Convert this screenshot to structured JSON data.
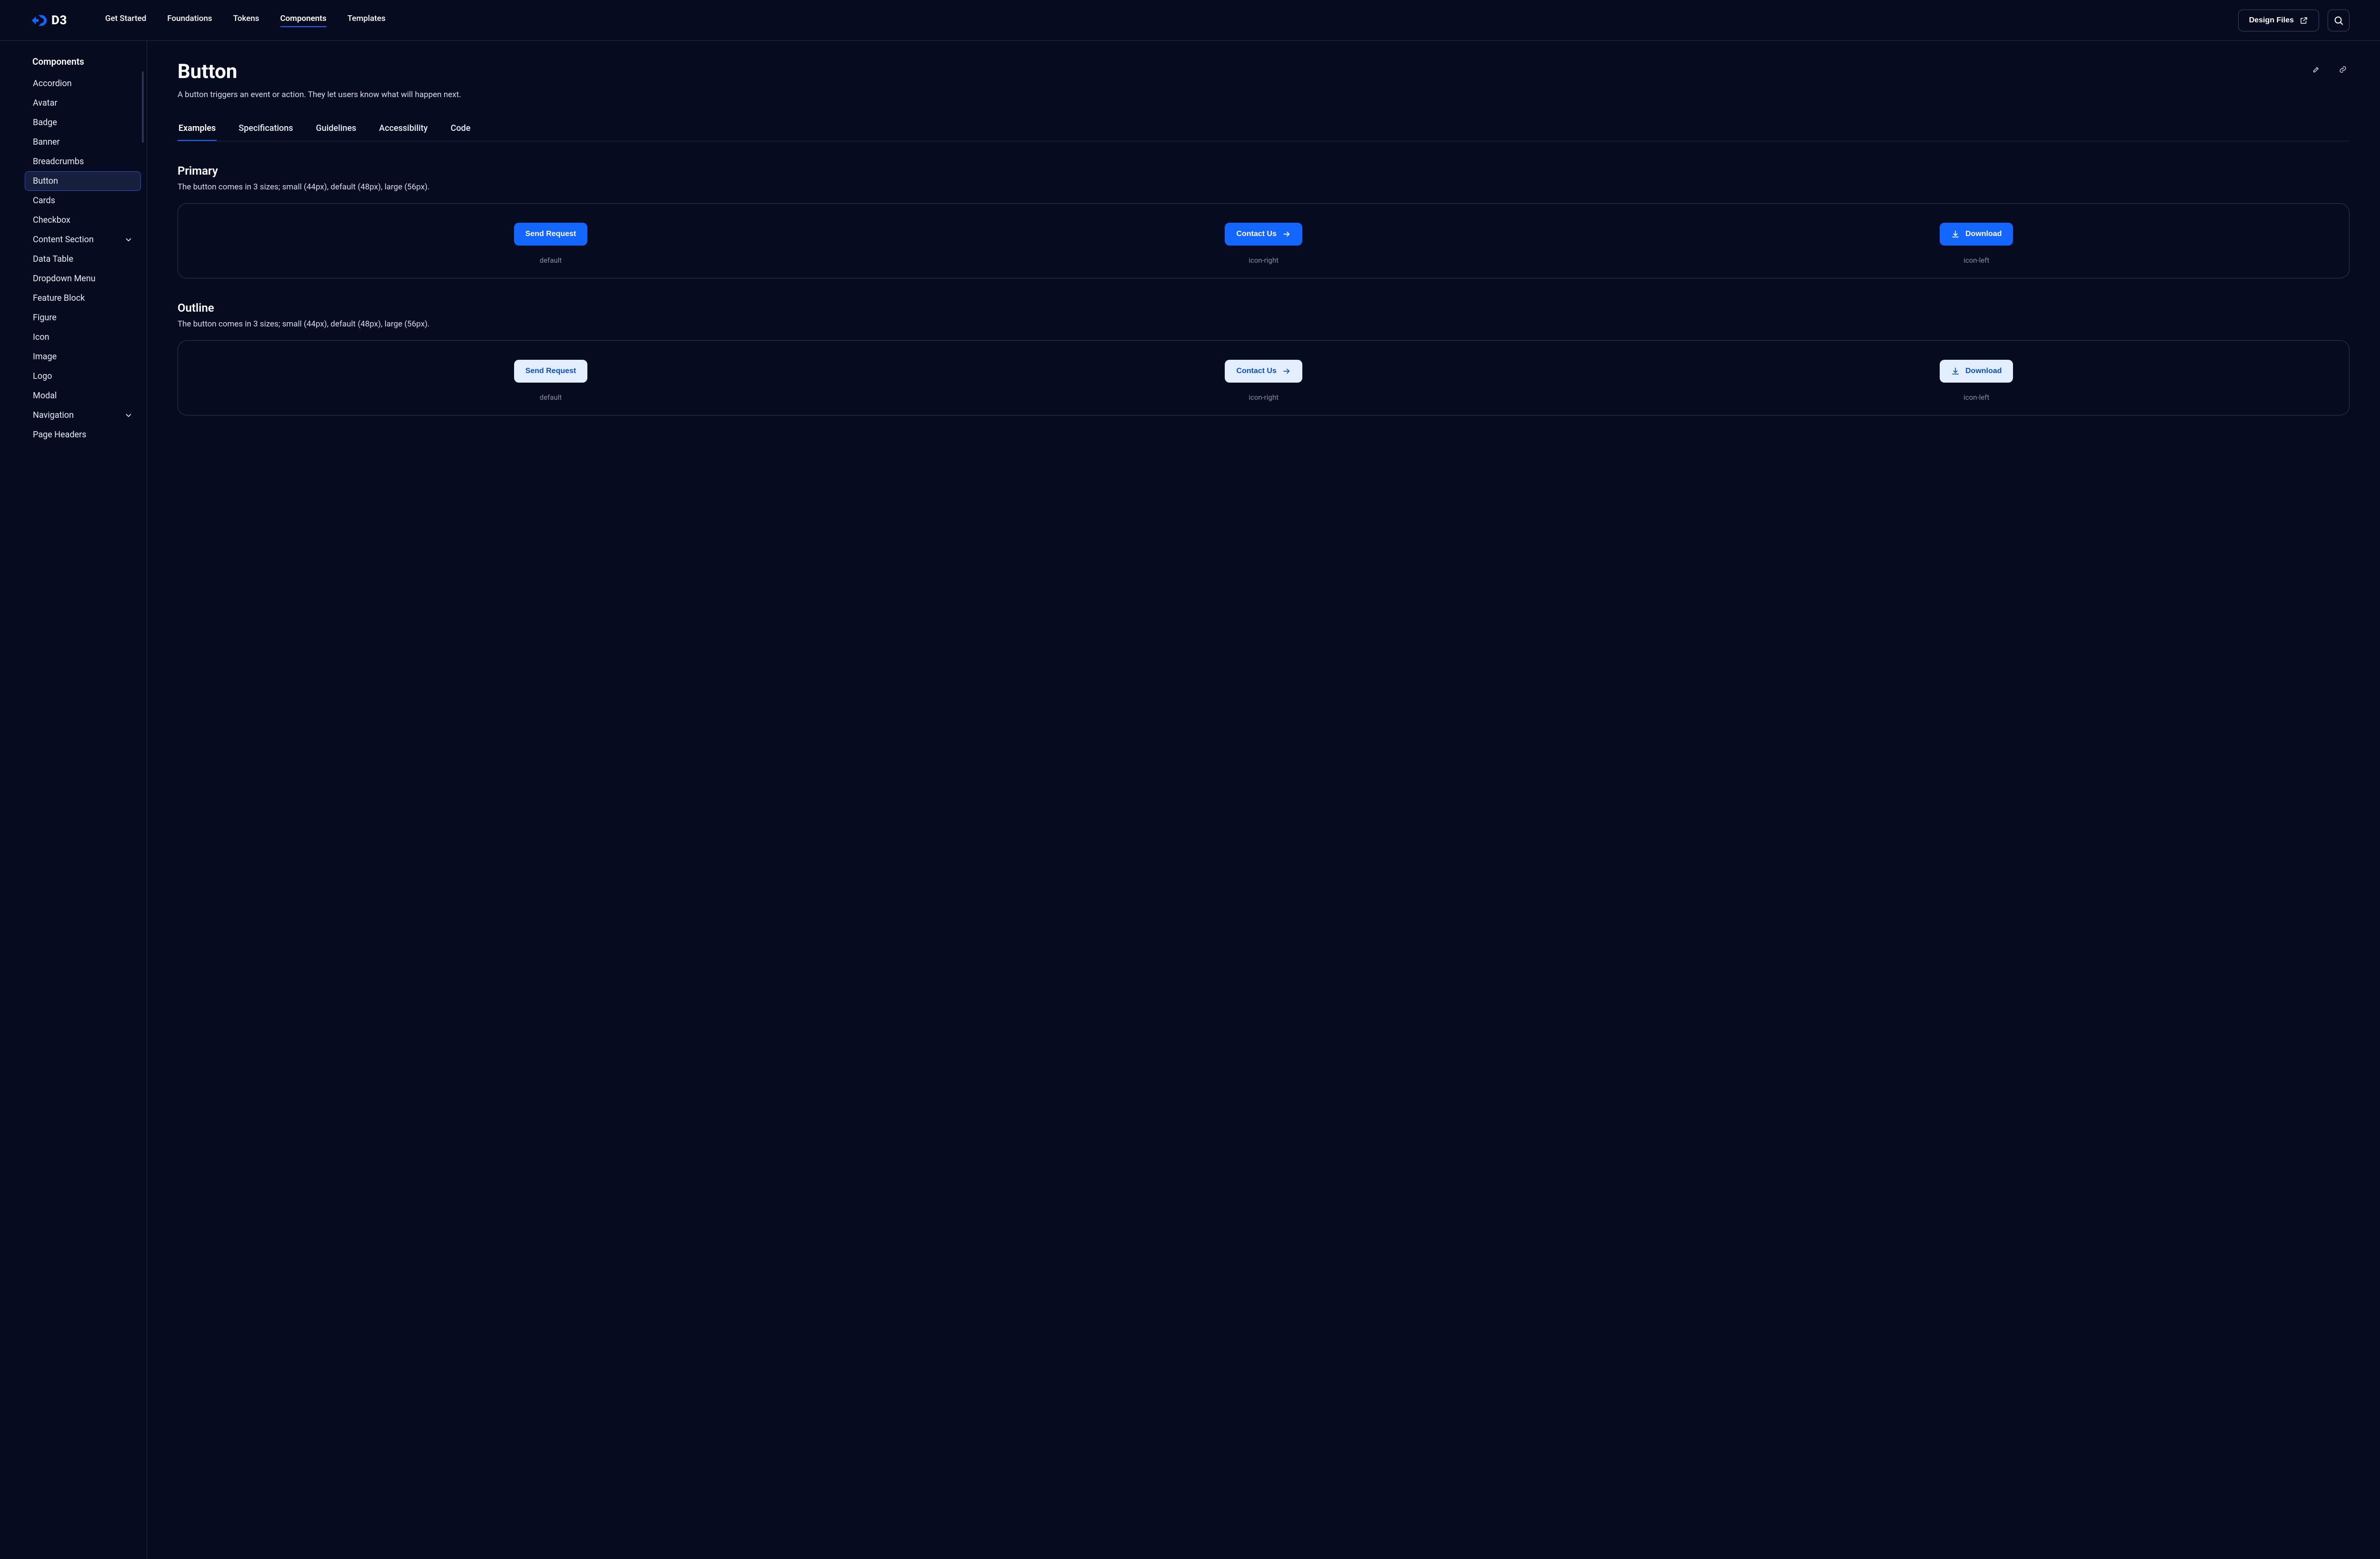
{
  "brand": "D3",
  "nav": {
    "items": [
      "Get Started",
      "Foundations",
      "Tokens",
      "Components",
      "Templates"
    ],
    "activeIndex": 3
  },
  "header": {
    "design_files": "Design Files"
  },
  "sidebar": {
    "title": "Components",
    "items": [
      {
        "label": "Accordion"
      },
      {
        "label": "Avatar"
      },
      {
        "label": "Badge"
      },
      {
        "label": "Banner"
      },
      {
        "label": "Breadcrumbs"
      },
      {
        "label": "Button",
        "active": true
      },
      {
        "label": "Cards"
      },
      {
        "label": "Checkbox"
      },
      {
        "label": "Content Section",
        "chevron": true
      },
      {
        "label": "Data Table"
      },
      {
        "label": "Dropdown Menu"
      },
      {
        "label": "Feature Block"
      },
      {
        "label": "Figure"
      },
      {
        "label": "Icon"
      },
      {
        "label": "Image"
      },
      {
        "label": "Logo"
      },
      {
        "label": "Modal"
      },
      {
        "label": "Navigation",
        "chevron": true
      },
      {
        "label": "Page Headers"
      }
    ]
  },
  "page": {
    "title": "Button",
    "description": "A button triggers an event or action. They let users know what will happen next."
  },
  "tabs": {
    "items": [
      "Examples",
      "Specifications",
      "Guidelines",
      "Accessibility",
      "Code"
    ],
    "activeIndex": 0
  },
  "sections": [
    {
      "title": "Primary",
      "desc": "The button comes in 3 sizes; small (44px), default (48px), large (56px).",
      "variant": "primary",
      "buttons": [
        {
          "label": "Send Request",
          "icon": null,
          "pos": null,
          "caption": "default"
        },
        {
          "label": "Contact Us",
          "icon": "arrow-right",
          "pos": "right",
          "caption": "icon-right"
        },
        {
          "label": "Download",
          "icon": "download",
          "pos": "left",
          "caption": "icon-left"
        }
      ]
    },
    {
      "title": "Outline",
      "desc": "The button comes in 3 sizes; small (44px), default (48px), large (56px).",
      "variant": "secondary",
      "buttons": [
        {
          "label": "Send Request",
          "icon": null,
          "pos": null,
          "caption": "default"
        },
        {
          "label": "Contact Us",
          "icon": "arrow-right",
          "pos": "right",
          "caption": "icon-right"
        },
        {
          "label": "Download",
          "icon": "download",
          "pos": "left",
          "caption": "icon-left"
        }
      ]
    }
  ]
}
